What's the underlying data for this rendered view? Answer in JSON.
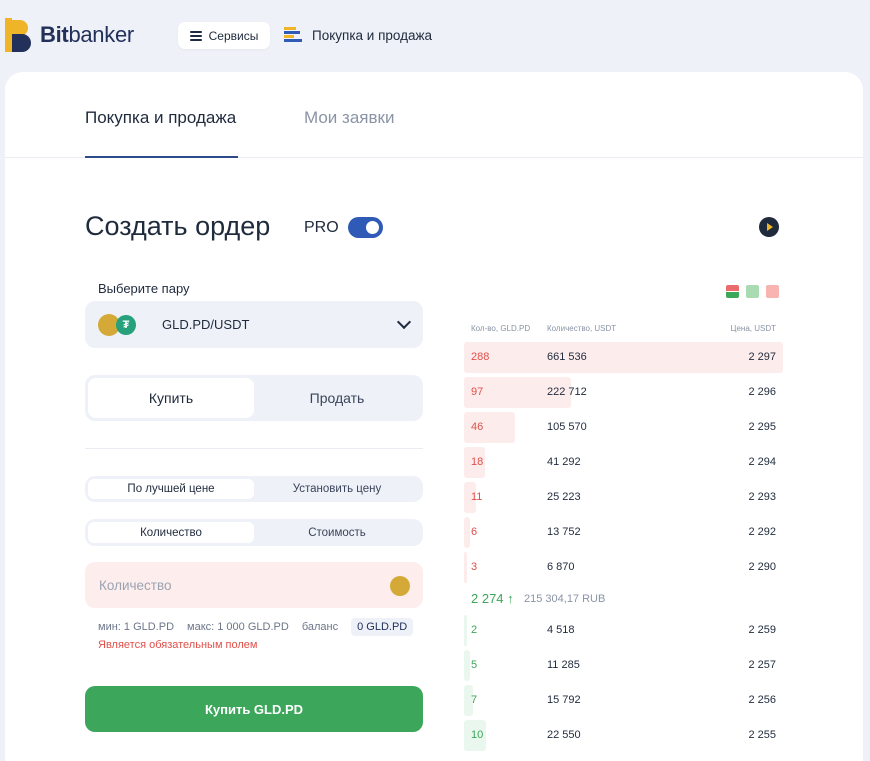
{
  "brand": {
    "name_bold": "Bit",
    "name_rest": "banker"
  },
  "topnav": {
    "services_label": "Сервисы",
    "trade_label": "Покупка и продажа"
  },
  "tabs": [
    {
      "label": "Покупка и продажа",
      "active": true
    },
    {
      "label": "Мои заявки",
      "active": false
    }
  ],
  "order": {
    "title": "Создать ордер",
    "pro_label": "PRO",
    "pro_enabled": true,
    "pair_label": "Выберите пару",
    "pair_value": "GLD.PD/USDT",
    "side_options": [
      "Купить",
      "Продать"
    ],
    "side_selected": "Купить",
    "price_mode_options": [
      "По лучшей цене",
      "Установить цену"
    ],
    "price_mode_selected": "По лучшей цене",
    "amount_mode_options": [
      "Количество",
      "Стоимость"
    ],
    "amount_mode_selected": "Количество",
    "quantity_placeholder": "Количество",
    "min_label": "мин: 1 GLD.PD",
    "max_label": "макс: 1 000 GLD.PD",
    "balance_label": "баланс",
    "balance_value": "0 GLD.PD",
    "error_text": "Является обязательным полем",
    "submit_label": "Купить GLD.PD"
  },
  "orderbook": {
    "headers": [
      "Кол-во, GLD.PD",
      "Количество, USDT",
      "Цена, USDT"
    ],
    "asks": [
      {
        "qty": "288",
        "total": "661 536",
        "price": "2 297",
        "depth": 1.0
      },
      {
        "qty": "97",
        "total": "222 712",
        "price": "2 296",
        "depth": 0.335
      },
      {
        "qty": "46",
        "total": "105 570",
        "price": "2 295",
        "depth": 0.16
      },
      {
        "qty": "18",
        "total": "41 292",
        "price": "2 294",
        "depth": 0.065
      },
      {
        "qty": "11",
        "total": "25 223",
        "price": "2 293",
        "depth": 0.038
      },
      {
        "qty": "6",
        "total": "13 752",
        "price": "2 292",
        "depth": 0.02
      },
      {
        "qty": "3",
        "total": "6 870",
        "price": "2 290",
        "depth": 0.01
      }
    ],
    "mid_price": "2 274 ↑",
    "mid_rub": "215 304,17 RUB",
    "bids": [
      {
        "qty": "2",
        "total": "4 518",
        "price": "2 259",
        "depth": 0.01
      },
      {
        "qty": "5",
        "total": "11 285",
        "price": "2 257",
        "depth": 0.02
      },
      {
        "qty": "7",
        "total": "15 792",
        "price": "2 256",
        "depth": 0.028
      },
      {
        "qty": "10",
        "total": "22 550",
        "price": "2 255",
        "depth": 0.07
      }
    ]
  },
  "colors": {
    "accent": "#2f5bb7",
    "buy": "#3ca65a",
    "sell": "#e0504a",
    "bg": "#eef1f8"
  }
}
